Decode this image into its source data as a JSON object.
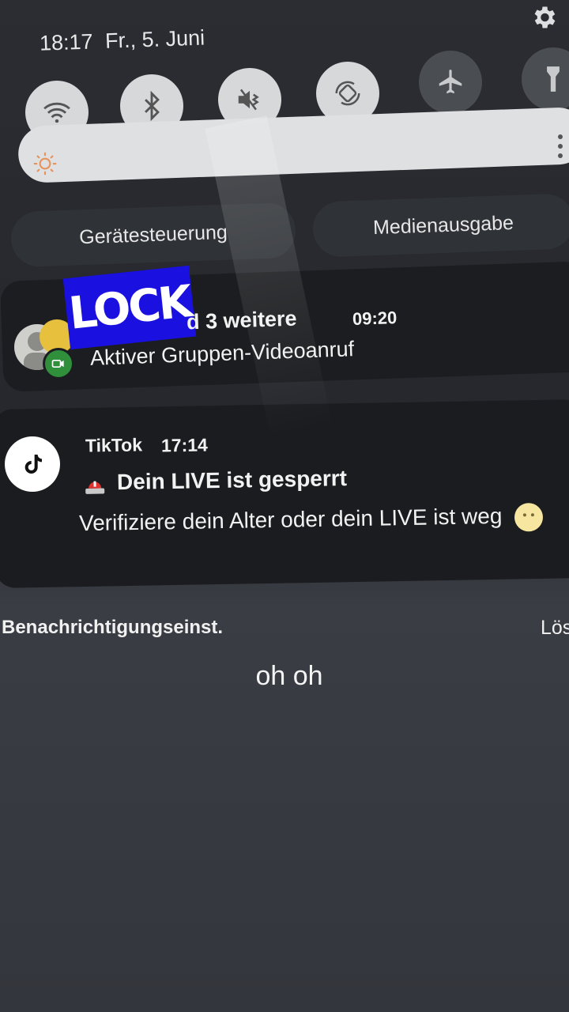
{
  "status_bar": {
    "time": "18:17",
    "date": "Fr., 5. Juni"
  },
  "quick_toggles": [
    {
      "name": "wifi-icon",
      "active": true
    },
    {
      "name": "bluetooth-icon",
      "active": true
    },
    {
      "name": "sound-off-icon",
      "active": true
    },
    {
      "name": "auto-rotate-icon",
      "active": true
    },
    {
      "name": "airplane-icon",
      "active": false
    },
    {
      "name": "flashlight-icon",
      "active": false
    }
  ],
  "buttons": {
    "device_control": "Gerätesteuerung",
    "media_output": "Medienausgabe"
  },
  "notification_call": {
    "title_visible": "d 3 weitere",
    "time": "09:20",
    "body": "Aktiver Gruppen-Videoanruf",
    "sticker": "LOCK"
  },
  "notification_tiktok": {
    "app": "TikTok",
    "time": "17:14",
    "title": "Dein LIVE ist gesperrt",
    "body": "Verifiziere dein Alter oder dein LIVE ist weg"
  },
  "footer": {
    "settings": "Benachrichtigungseinst.",
    "clear": "Lös"
  },
  "caption": "oh oh",
  "colors": {
    "toggle_active": "#d7d8da",
    "toggle_inactive": "#4a4d52",
    "sticker_bg": "#1a10e0",
    "video_badge": "#2f8f3b"
  }
}
